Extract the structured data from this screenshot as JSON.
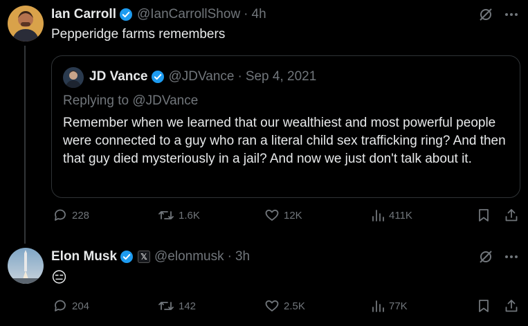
{
  "posts": [
    {
      "author": "Ian Carroll",
      "handle": "@IanCarrollShow",
      "sep": "·",
      "time": "4h",
      "text": "Pepperidge farms remembers",
      "quote": {
        "author": "JD Vance",
        "handle": "@JDVance",
        "sep": "·",
        "date": "Sep 4, 2021",
        "replying": "Replying to @JDVance",
        "text": "Remember when we learned that our wealthiest and most powerful people were connected to a guy who ran a literal child sex trafficking ring? And then that guy died mysteriously in a jail? And now we just don't talk about it."
      },
      "stats": {
        "replies": "228",
        "reposts": "1.6K",
        "likes": "12K",
        "views": "411K"
      }
    },
    {
      "author": "Elon Musk",
      "affiliate": "𝕏",
      "handle": "@elonmusk",
      "sep": "·",
      "time": "3h",
      "text": "😑",
      "stats": {
        "replies": "204",
        "reposts": "142",
        "likes": "2.5K",
        "views": "77K"
      }
    }
  ],
  "colors": {
    "verified": "#1d9bf0",
    "muted": "#71767b",
    "text": "#e7e9ea",
    "background": "#000000"
  }
}
